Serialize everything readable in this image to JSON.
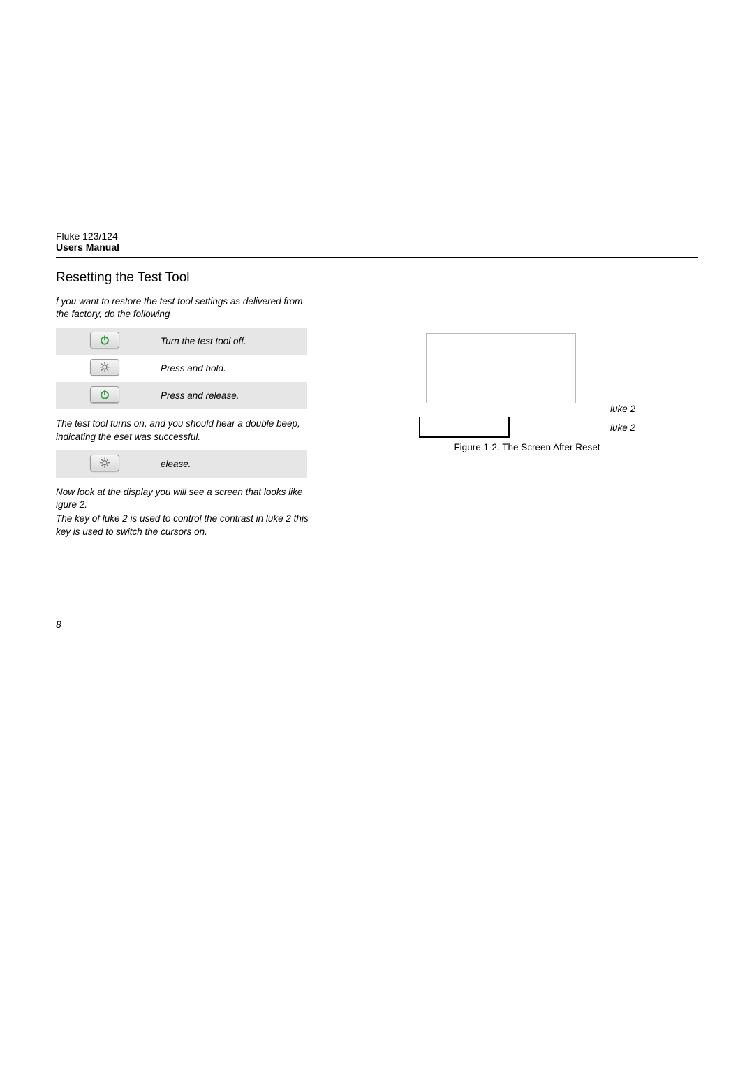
{
  "header": {
    "line1": "Fluke 123/124",
    "line2": "Users Manual"
  },
  "section_title": "Resetting the Test Tool",
  "intro": "f you want to restore the test tool settings as delivered from the factory, do the following",
  "steps": [
    {
      "icon": "power",
      "text": "Turn the test tool off."
    },
    {
      "icon": "brightness",
      "text": "Press and hold."
    },
    {
      "icon": "power",
      "text": "Press and release."
    }
  ],
  "mid_para": "The test tool turns on, and you should hear a double beep, indicating the eset was successful.",
  "step_release": {
    "icon": "brightness",
    "text": "elease."
  },
  "after_para1": "Now look at the display you will see a screen that looks like igure 2.",
  "after_para2": "The  key of luke 2 is used to control the contrast in luke 2 this key is used to switch the cursors on.",
  "figure": {
    "label_mid": "luke 2",
    "label_bottom": "luke 2",
    "caption": "Figure 1-2. The Screen After Reset"
  },
  "page_number": "8"
}
